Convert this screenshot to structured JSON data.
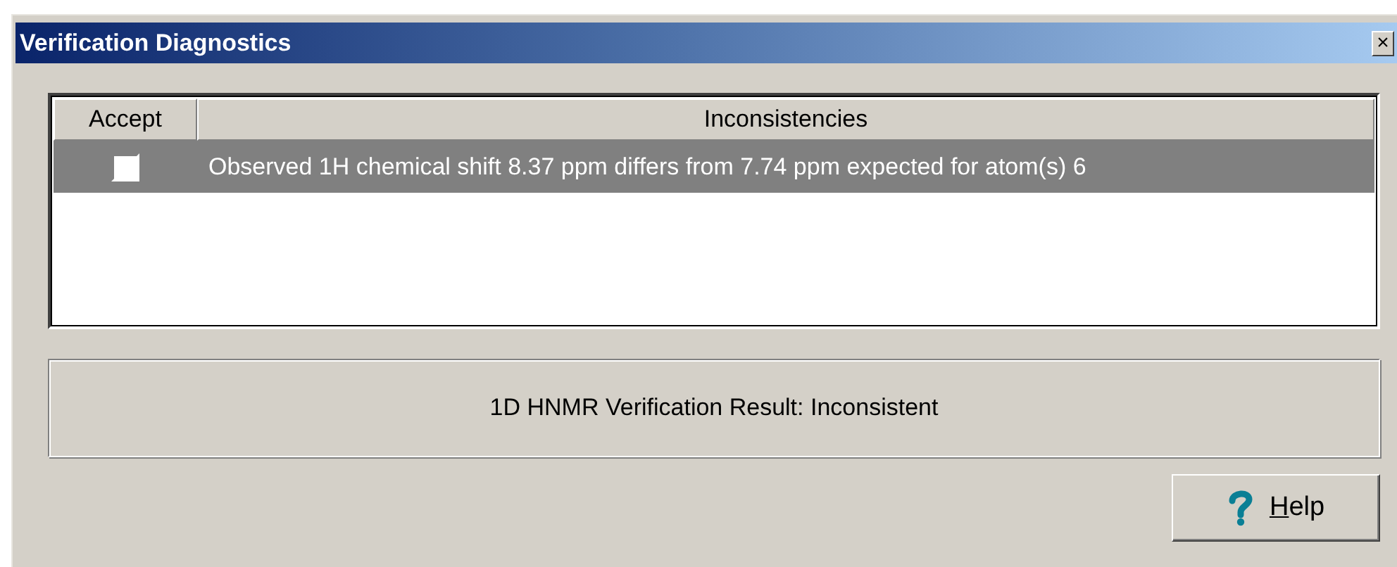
{
  "window": {
    "title": "Verification Diagnostics",
    "close": "×"
  },
  "table": {
    "columns": [
      "Accept",
      "Inconsistencies"
    ],
    "rows": [
      {
        "checked": false,
        "selected": true,
        "text": "Observed 1H chemical shift 8.37 ppm differs from 7.74 ppm expected for atom(s) 6"
      }
    ]
  },
  "result": "1D HNMR Verification Result: Inconsistent",
  "buttons": [
    {
      "label": "Help"
    }
  ]
}
